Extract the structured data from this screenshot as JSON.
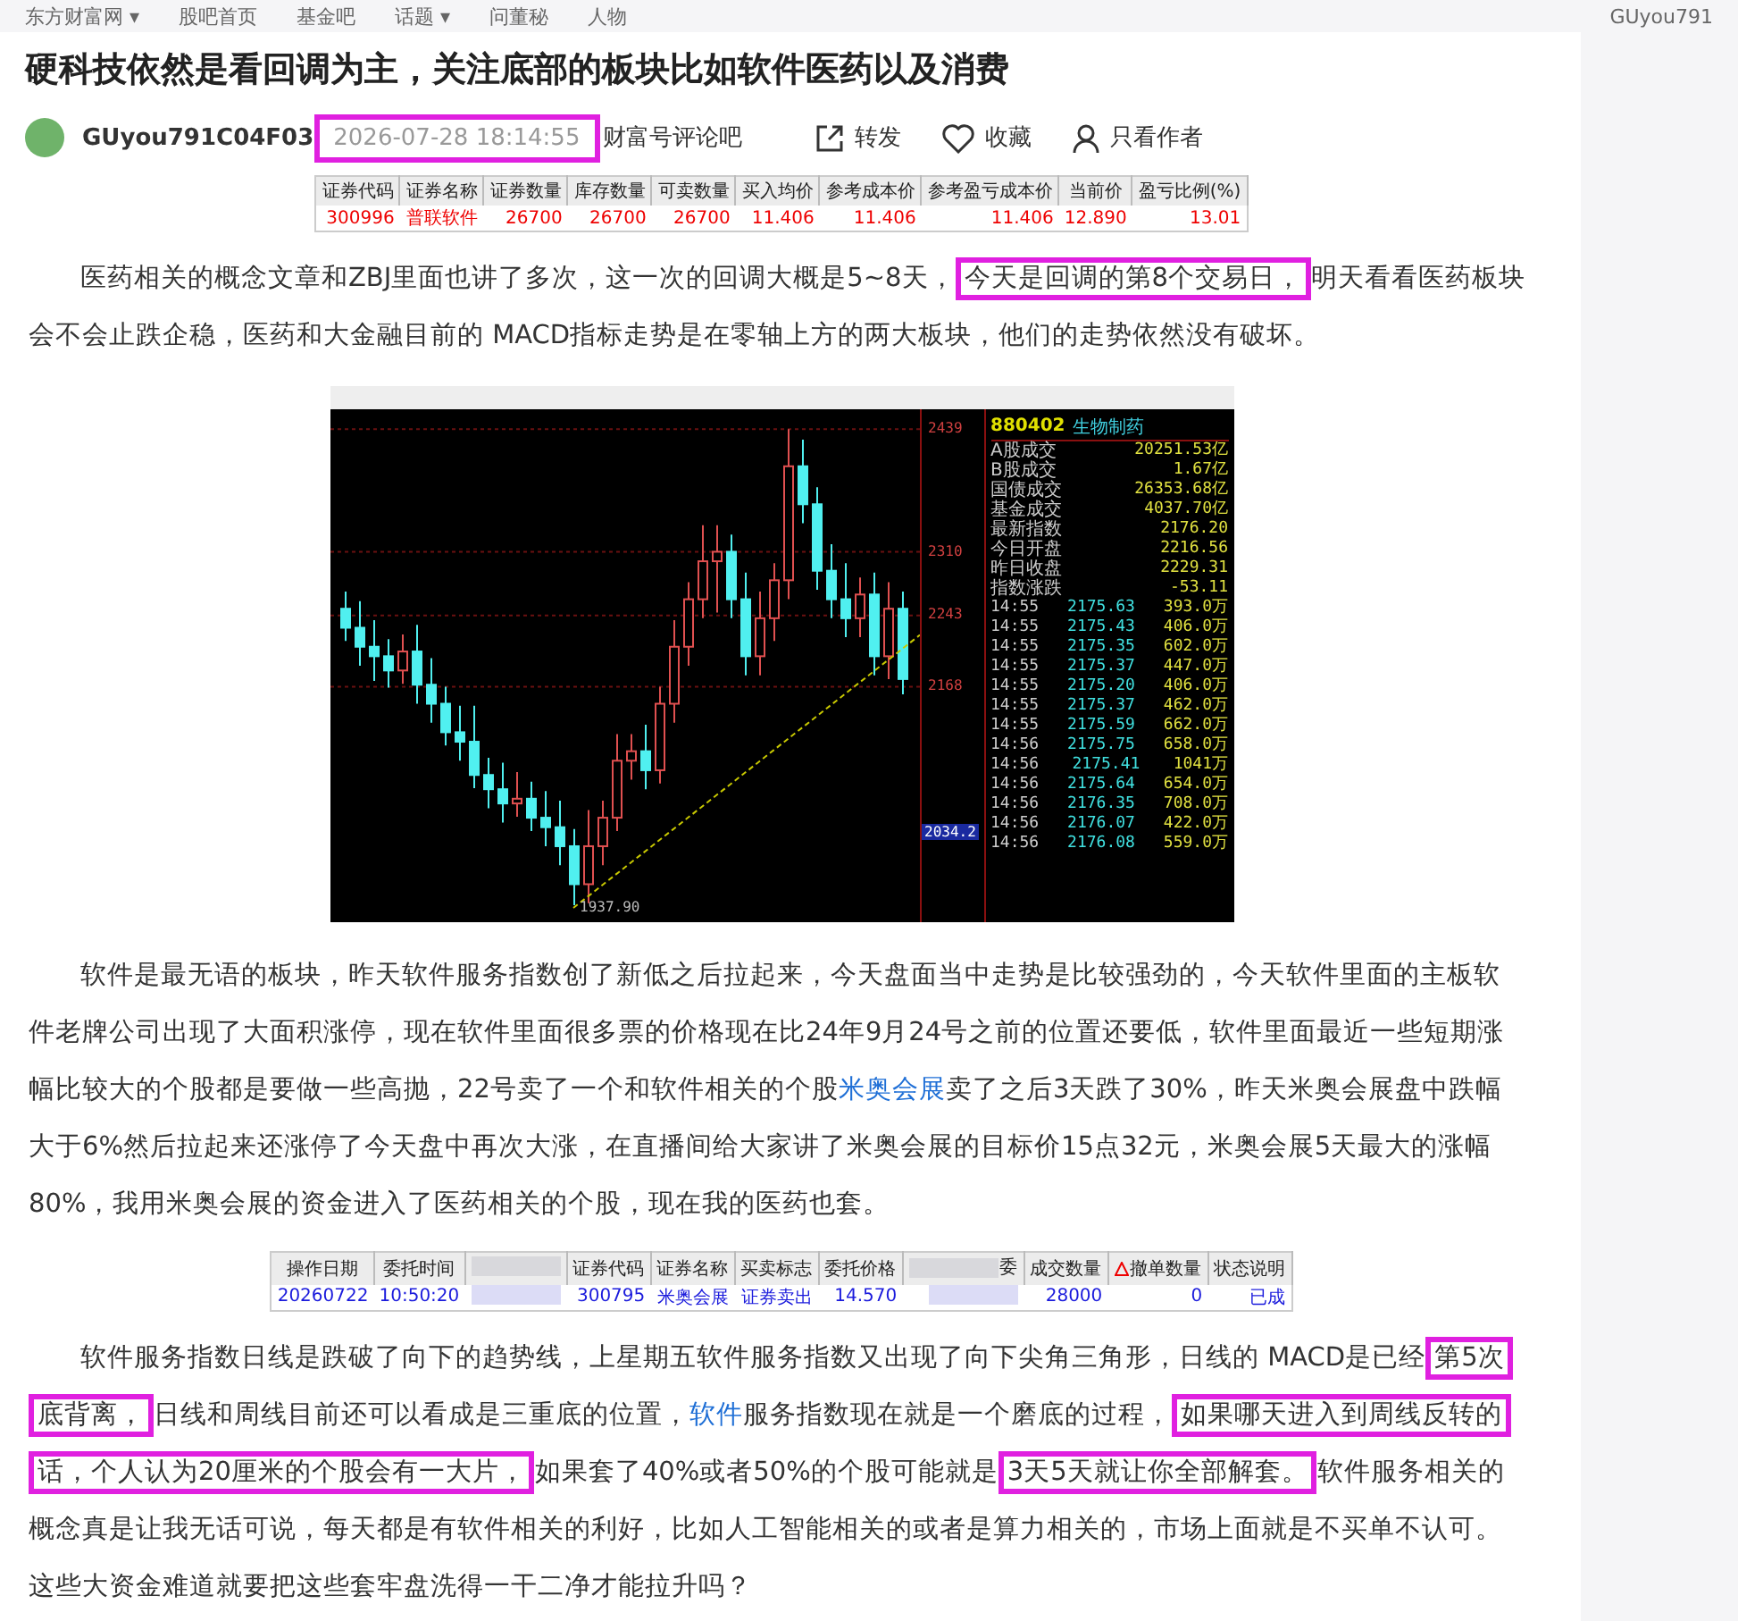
{
  "top_nav": {
    "items": [
      "东方财富网 ▾",
      "股吧首页",
      "基金吧",
      "话题 ▾",
      "问董秘",
      "人物"
    ],
    "user": "GUyou791"
  },
  "post": {
    "title": "硬科技依然是看回调为主，关注底部的板块比如软件医药以及消费",
    "author": "GUyou791C04F03",
    "time": "2026-07-28 18:14:55",
    "time_boxed": true,
    "forum": "财富号评论吧",
    "actions": [
      {
        "kind": "share",
        "label": "转发"
      },
      {
        "kind": "favorite",
        "label": "收藏"
      },
      {
        "kind": "author",
        "label": "只看作者"
      }
    ]
  },
  "blocks": [
    {
      "kind": "table",
      "columns": [
        "证券代码",
        "证券名称",
        "证券数量",
        "库存数量",
        "可卖数量",
        "买入均价",
        "参考成本价",
        "参考盈亏成本价",
        "当前价",
        "盈亏比例(%)"
      ],
      "rows": [
        [
          "300996",
          "普联软件",
          "26700",
          "26700",
          "26700",
          "11.406",
          "11.406",
          "11.406",
          "12.890",
          "13.01"
        ]
      ]
    },
    {
      "kind": "paragraph",
      "segments": [
        {
          "kind": "text",
          "text": "医药相关的概念文章和ZBJ里面也讲了多次，这一次的回调大概是5~8天，"
        },
        {
          "kind": "boxed",
          "text": "今天是回调的第8个交易日，"
        },
        {
          "kind": "text",
          "text": "明天看看医药板块会不会止跌企稳，医药和大金融目前的 MACD指标走势是在零轴上方的两大板块，他们的走势依然没有破坏。"
        }
      ]
    },
    {
      "kind": "chart_image",
      "header_code": "880402",
      "header_name": "生物制药",
      "current_label": "2034.2",
      "low_label": "1937.90",
      "chart_data": {
        "type": "candlestick",
        "ylim": [
          1920,
          2460
        ],
        "grid": true,
        "ohlc": [
          [
            2250,
            2268,
            2216,
            2230
          ],
          [
            2230,
            2258,
            2190,
            2210
          ],
          [
            2210,
            2238,
            2174,
            2200
          ],
          [
            2200,
            2218,
            2167,
            2185
          ],
          [
            2185,
            2223,
            2171,
            2205
          ],
          [
            2205,
            2233,
            2150,
            2170
          ],
          [
            2170,
            2198,
            2130,
            2150
          ],
          [
            2150,
            2168,
            2106,
            2120
          ],
          [
            2120,
            2148,
            2090,
            2110
          ],
          [
            2110,
            2148,
            2061,
            2075
          ],
          [
            2075,
            2093,
            2040,
            2060
          ],
          [
            2060,
            2088,
            2025,
            2045
          ],
          [
            2045,
            2078,
            2031,
            2050
          ],
          [
            2050,
            2068,
            2016,
            2030
          ],
          [
            2030,
            2058,
            2000,
            2020
          ],
          [
            2020,
            2048,
            1980,
            2000
          ],
          [
            2000,
            2018,
            1937.9,
            1960
          ],
          [
            1960,
            2038,
            1940,
            2000
          ],
          [
            2000,
            2048,
            1980,
            2030
          ],
          [
            2030,
            2118,
            2016,
            2090
          ],
          [
            2090,
            2118,
            2070,
            2100
          ],
          [
            2100,
            2128,
            2060,
            2080
          ],
          [
            2080,
            2168,
            2066,
            2150
          ],
          [
            2150,
            2238,
            2130,
            2210
          ],
          [
            2210,
            2278,
            2190,
            2260
          ],
          [
            2260,
            2338,
            2240,
            2300
          ],
          [
            2300,
            2338,
            2246,
            2310
          ],
          [
            2310,
            2328,
            2240,
            2260
          ],
          [
            2260,
            2288,
            2180,
            2200
          ],
          [
            2200,
            2268,
            2180,
            2240
          ],
          [
            2240,
            2298,
            2216,
            2280
          ],
          [
            2280,
            2439,
            2260,
            2400
          ],
          [
            2400,
            2428,
            2340,
            2360
          ],
          [
            2360,
            2378,
            2270,
            2290
          ],
          [
            2290,
            2318,
            2240,
            2260
          ],
          [
            2260,
            2298,
            2220,
            2240
          ],
          [
            2240,
            2283,
            2220,
            2265
          ],
          [
            2265,
            2288,
            2180,
            2200
          ],
          [
            2200,
            2278,
            2176,
            2250
          ],
          [
            2250,
            2268,
            2160,
            2176
          ]
        ],
        "yticks": [
          {
            "value": 2439,
            "label": "2439"
          },
          {
            "value": 2310,
            "label": "2310"
          },
          {
            "value": 2243,
            "label": "2243"
          },
          {
            "value": 2168,
            "label": "2168"
          }
        ]
      },
      "stats": [
        {
          "label": "A股成交",
          "value": "20251.53亿"
        },
        {
          "label": "B股成交",
          "value": "1.67亿"
        },
        {
          "label": "国债成交",
          "value": "26353.68亿"
        },
        {
          "label": "基金成交",
          "value": "4037.70亿"
        },
        {
          "label": "最新指数",
          "value": "2176.20"
        },
        {
          "label": "今日开盘",
          "value": "2216.56"
        },
        {
          "label": "昨日收盘",
          "value": "2229.31"
        },
        {
          "label": "指数涨跌",
          "value": "-53.11"
        }
      ],
      "ticks": [
        [
          "14:55",
          "2175.63",
          "393.0万"
        ],
        [
          "14:55",
          "2175.43",
          "406.0万"
        ],
        [
          "14:55",
          "2175.35",
          "602.0万"
        ],
        [
          "14:55",
          "2175.37",
          "447.0万"
        ],
        [
          "14:55",
          "2175.20",
          "406.0万"
        ],
        [
          "14:55",
          "2175.37",
          "462.0万"
        ],
        [
          "14:55",
          "2175.59",
          "662.0万"
        ],
        [
          "14:56",
          "2175.75",
          "658.0万"
        ],
        [
          "14:56",
          "2175.41",
          "1041万"
        ],
        [
          "14:56",
          "2175.64",
          "654.0万"
        ],
        [
          "14:56",
          "2176.35",
          "708.0万"
        ],
        [
          "14:56",
          "2176.07",
          "422.0万"
        ],
        [
          "14:56",
          "2176.08",
          "559.0万"
        ]
      ]
    },
    {
      "kind": "paragraph",
      "segments": [
        {
          "kind": "text",
          "text": "软件是最无语的板块，昨天软件服务指数创了新低之后拉起来，今天盘面当中走势是比较强劲的，今天软件里面的主板软件老牌公司出现了大面积涨停，现在软件里面很多票的价格现在比24年9月24号之前的位置还要低，软件里面最近一些短期涨幅比较大的个股都是要做一些高抛，22号卖了一个和软件相关的个股"
        },
        {
          "kind": "link",
          "text": "米奥会展"
        },
        {
          "kind": "text",
          "text": "卖了之后3天跌了30%，昨天米奥会展盘中跌幅大于6%然后拉起来还涨停了今天盘中再次大涨，在直播间给大家讲了米奥会展的目标价15点32元，米奥会展5天最大的涨幅80%，我用米奥会展的资金进入了医药相关的个股，现在我的医药也套。"
        }
      ]
    },
    {
      "kind": "order_table",
      "columns": [
        {
          "label": "操作日期"
        },
        {
          "label": "委托时间"
        },
        {
          "blurred": true
        },
        {
          "label": "证券代码"
        },
        {
          "label": "证券名称"
        },
        {
          "label": "买卖标志"
        },
        {
          "label": "委托价格"
        },
        {
          "label": "委",
          "blurred": true
        },
        {
          "label": "成交数量"
        },
        {
          "label": "撤单数量",
          "warning": true
        },
        {
          "label": "状态说明"
        }
      ],
      "row": [
        {
          "text": "20260722"
        },
        {
          "text": "10:50:20"
        },
        {
          "blurred": true
        },
        {
          "text": "300795"
        },
        {
          "text": "米奥会展"
        },
        {
          "text": "证券卖出"
        },
        {
          "text": "14.570"
        },
        {
          "blurred": true
        },
        {
          "text": "28000"
        },
        {
          "text": "0"
        },
        {
          "text": "已成"
        }
      ]
    },
    {
      "kind": "paragraph",
      "segments": [
        {
          "kind": "text",
          "text": "软件服务指数日线是跌破了向下的趋势线，上星期五软件服务指数又出现了向下尖角三角形，日线的 MACD是已经"
        },
        {
          "kind": "boxed",
          "text": "第5次底背离，"
        },
        {
          "kind": "text",
          "text": "日线和周线目前还可以看成是三重底的位置，"
        },
        {
          "kind": "link",
          "text": "软件"
        },
        {
          "kind": "text",
          "text": "服务指数现在就是一个磨底的过程，"
        },
        {
          "kind": "boxed",
          "text": "如果哪天进入到周线反转的话，个人认为20厘米的个股会有一大片，"
        },
        {
          "kind": "text",
          "text": "如果套了40%或者50%的个股可能就是"
        },
        {
          "kind": "boxed",
          "text": "3天5天就让你全部解套。"
        },
        {
          "kind": "text",
          "text": "软件服务相关的概念真是让我无话可说，每天都是有软件相关的利好，比如人工智能相关的或者是算力相关的，市场上面就是不买单不认可。这些大资金难道就要把这些套牢盘洗得一干二净才能拉升吗？"
        }
      ]
    }
  ]
}
